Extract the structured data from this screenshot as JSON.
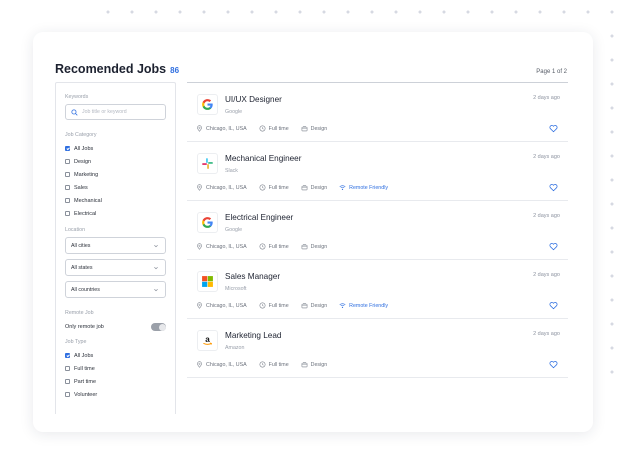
{
  "header": {
    "title": "Recomended Jobs",
    "count": "86",
    "page": "Page 1 of 2"
  },
  "filters": {
    "keywords_label": "Keywords",
    "search_placeholder": "Job title or keyword",
    "category_label": "Job Category",
    "categories": [
      {
        "label": "All Jobs",
        "checked": true
      },
      {
        "label": "Design",
        "checked": false
      },
      {
        "label": "Marketing",
        "checked": false
      },
      {
        "label": "Sales",
        "checked": false
      },
      {
        "label": "Mechanical",
        "checked": false
      },
      {
        "label": "Electrical",
        "checked": false
      }
    ],
    "location_label": "Location",
    "cities": "All cities",
    "states": "All states",
    "countries": "All countries",
    "remote_label": "Remote Job",
    "remote_toggle_label": "Only remote job",
    "jobtype_label": "Job Type",
    "jobtypes": [
      {
        "label": "All Jobs",
        "checked": true
      },
      {
        "label": "Full time",
        "checked": false
      },
      {
        "label": "Part time",
        "checked": false
      },
      {
        "label": "Volunteer",
        "checked": false
      }
    ]
  },
  "jobs": [
    {
      "title": "UI/UX Designer",
      "company": "Google",
      "date": "2 days ago",
      "location": "Chicago, IL, USA",
      "type": "Full time",
      "category": "Design",
      "remote": ""
    },
    {
      "title": "Mechanical Engineer",
      "company": "Slack",
      "date": "2 days ago",
      "location": "Chicago, IL, USA",
      "type": "Full time",
      "category": "Design",
      "remote": "Remote Friendly"
    },
    {
      "title": "Electrical Engineer",
      "company": "Google",
      "date": "2 days ago",
      "location": "Chicago, IL, USA",
      "type": "Full time",
      "category": "Design",
      "remote": ""
    },
    {
      "title": "Sales Manager",
      "company": "Microsoft",
      "date": "2 days ago",
      "location": "Chicago, IL, USA",
      "type": "Full time",
      "category": "Design",
      "remote": "Remote Friendly"
    },
    {
      "title": "Marketing Lead",
      "company": "Amazon",
      "date": "2 days ago",
      "location": "Chicago, IL, USA",
      "type": "Full time",
      "category": "Design",
      "remote": ""
    }
  ],
  "icons": {
    "logos": [
      "google-logo-icon",
      "slack-logo-icon",
      "google-logo-icon",
      "microsoft-logo-icon",
      "amazon-logo-icon"
    ],
    "location": "location-pin-icon",
    "type": "clock-icon",
    "category": "briefcase-icon",
    "remote": "wifi-icon",
    "save": "heart-icon"
  },
  "colors": {
    "accent": "#2f6fe0",
    "border": "#e3e5ea"
  }
}
